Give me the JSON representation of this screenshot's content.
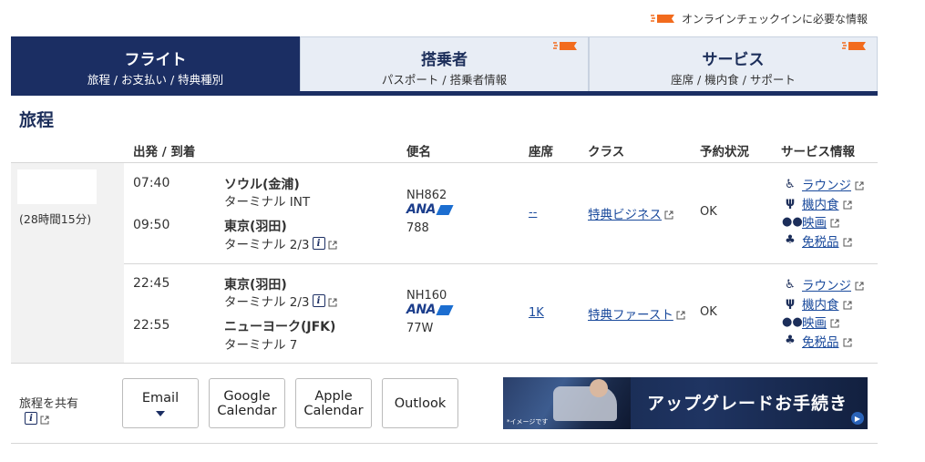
{
  "top_note": "オンラインチェックインに必要な情報",
  "tabs": [
    {
      "title": "フライト",
      "sub": "旅程 / お支払い / 特典種別",
      "active": true
    },
    {
      "title": "搭乗者",
      "sub": "パスポート / 搭乗者情報",
      "active": false
    },
    {
      "title": "サービス",
      "sub": "座席 / 機内食 / サポート",
      "active": false
    }
  ],
  "section_title": "旅程",
  "headers": {
    "dep_arr": "出発 / 到着",
    "flight": "便名",
    "seat": "座席",
    "cls": "クラス",
    "status": "予約状況",
    "service": "サービス情報"
  },
  "duration": "(28時間15分)",
  "segments": [
    {
      "dep_time": "07:40",
      "dep_city": "ソウル(金浦)",
      "dep_term": "ターミナル INT",
      "arr_time": "09:50",
      "arr_city": "東京(羽田)",
      "arr_term": "ターミナル 2/3",
      "flight_no": "NH862",
      "airline": "ANA",
      "equipment": "788",
      "seat": "--",
      "cls": "特典ビジネス",
      "status": "OK"
    },
    {
      "dep_time": "22:45",
      "dep_city": "東京(羽田)",
      "dep_term": "ターミナル 2/3",
      "arr_time": "22:55",
      "arr_city": "ニューヨーク(JFK)",
      "arr_term": "ターミナル 7",
      "flight_no": "NH160",
      "airline": "ANA",
      "equipment": "77W",
      "seat": "1K",
      "cls": "特典ファースト",
      "status": "OK"
    }
  ],
  "services": [
    "ラウンジ",
    "機内食",
    "映画",
    "免税品"
  ],
  "service_icons": [
    "lounge-icon",
    "meal-icon",
    "movie-icon",
    "duty-free-icon"
  ],
  "share_label": "旅程を共有",
  "calendar_buttons": [
    {
      "line1": "Email",
      "line2": ""
    },
    {
      "line1": "Google",
      "line2": "Calendar"
    },
    {
      "line1": "Apple",
      "line2": "Calendar"
    },
    {
      "line1": "Outlook",
      "line2": ""
    }
  ],
  "banner": {
    "text": "アップグレードお手続き",
    "note": "*イメージです"
  },
  "colors": {
    "navy": "#1b2e63",
    "link": "#1a4a9c",
    "flag": "#f26b1d"
  }
}
